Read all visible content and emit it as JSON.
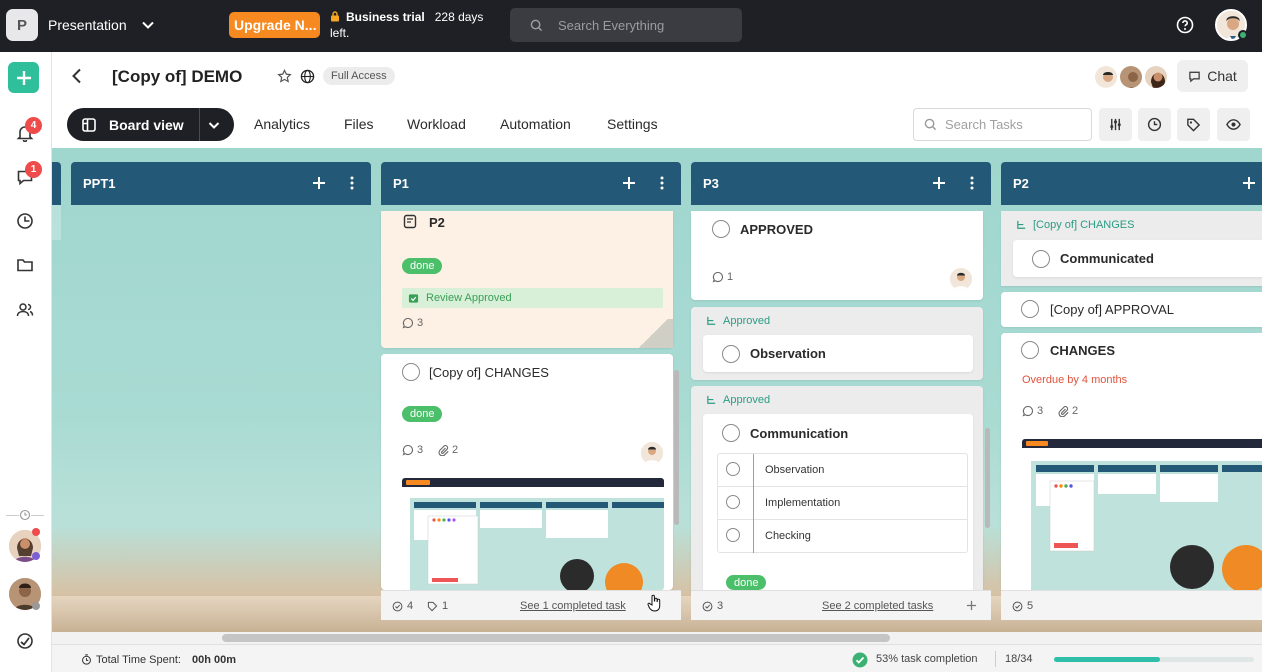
{
  "topbar": {
    "workspace_initial": "P",
    "workspace_name": "Presentation",
    "upgrade_label": "Upgrade N...",
    "trial_label": "Business trial",
    "trial_days": "228 days",
    "trial_suffix": "left.",
    "search_placeholder": "Search Everything"
  },
  "sidebar": {
    "notifications_count": "4",
    "messages_count": "1"
  },
  "header": {
    "project_title": "[Copy of] DEMO",
    "access_label": "Full Access",
    "chat_label": "Chat",
    "board_view_label": "Board view",
    "tabs": [
      {
        "label": "Analytics"
      },
      {
        "label": "Files"
      },
      {
        "label": "Workload"
      },
      {
        "label": "Automation"
      },
      {
        "label": "Settings"
      }
    ],
    "task_search_placeholder": "Search Tasks"
  },
  "columns": {
    "ppt1": {
      "title": "PPT1"
    },
    "p1": {
      "title": "P1",
      "card1": {
        "title": "P2",
        "status": "done",
        "review": "Review Approved",
        "comments": "3"
      },
      "card2": {
        "title": "[Copy of] CHANGES",
        "status": "done",
        "comments": "3",
        "attachments": "2"
      },
      "footer": {
        "done_count": "4",
        "attach_count": "1",
        "completed_link": "See 1 completed task"
      }
    },
    "p3": {
      "title": "P3",
      "card1": {
        "title": "APPROVED",
        "comments": "1"
      },
      "group1": {
        "label": "Approved",
        "task": "Observation"
      },
      "group2": {
        "label": "Approved",
        "task": "Communication",
        "subtasks": [
          {
            "label": "Observation"
          },
          {
            "label": "Implementation"
          },
          {
            "label": "Checking"
          }
        ],
        "status": "done"
      },
      "footer": {
        "done_count": "3",
        "completed_link": "See 2 completed tasks"
      }
    },
    "p2": {
      "title": "P2",
      "group": {
        "label": "[Copy of] CHANGES",
        "task": "Communicated"
      },
      "card2": {
        "title": "[Copy of] APPROVAL"
      },
      "card3": {
        "title": "CHANGES",
        "overdue": "Overdue by 4 months",
        "comments": "3",
        "attachments": "2"
      },
      "footer": {
        "done_count": "5"
      }
    }
  },
  "statusbar": {
    "time_label": "Total Time Spent:",
    "time_value": "00h 00m",
    "completion": "53% task completion",
    "ratio": "18/34",
    "progress_fraction": 0.53
  },
  "colors": {
    "accent": "#2fbf9a",
    "column_header": "#235877",
    "done": "#4cbf6b",
    "upgrade": "#f6891f",
    "overdue": "#e0533d"
  }
}
